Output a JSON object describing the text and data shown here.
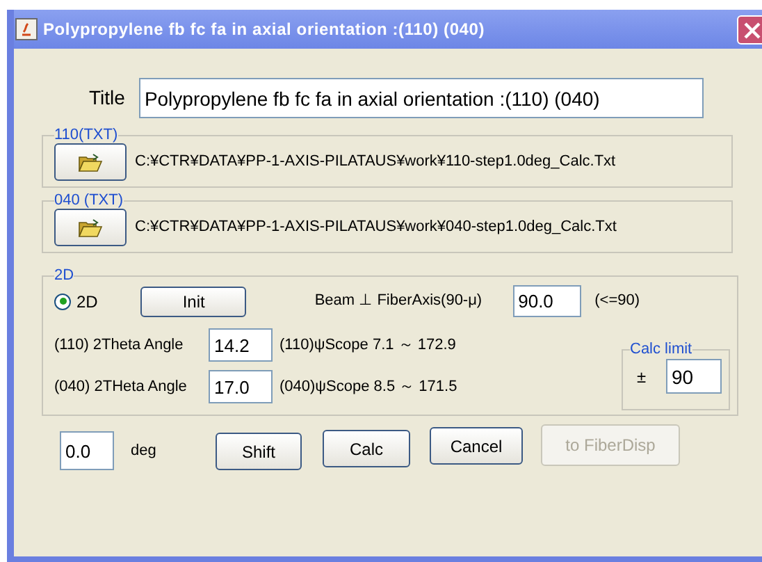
{
  "window": {
    "title": "Polypropylene fb fc fa in axial orientation :(110) (040)"
  },
  "title_field": {
    "label": "Title",
    "value": "Polypropylene fb fc fa in axial orientation :(110) (040)"
  },
  "files": [
    {
      "legend": "110(TXT)",
      "path": "C:¥CTR¥DATA¥PP-1-AXIS-PILATAUS¥work¥110-step1.0deg_Calc.Txt"
    },
    {
      "legend": "040 (TXT)",
      "path": "C:¥CTR¥DATA¥PP-1-AXIS-PILATAUS¥work¥040-step1.0deg_Calc.Txt"
    }
  ],
  "group_2d": {
    "legend": "2D",
    "radio": {
      "label": "2D",
      "selected": true
    },
    "init_button": "Init",
    "beam_label": "Beam ⊥ FiberAxis(90-μ)",
    "beam_value": "90.0",
    "beam_hint": "(<=90)",
    "angles": [
      {
        "label": "(110) 2Theta Angle",
        "value": "14.2",
        "scope": "(110)ψScope 7.1 ～ 172.9"
      },
      {
        "label": "(040) 2THeta Angle",
        "value": "17.0",
        "scope": "(040)ψScope 8.5 ～ 171.5"
      }
    ],
    "calc_limit": {
      "legend": "Calc limit",
      "sign": "±",
      "value": "90"
    }
  },
  "shift": {
    "value": "0.0",
    "unit": "deg"
  },
  "buttons": [
    {
      "label": "Shift",
      "disabled": false
    },
    {
      "label": "Calc",
      "disabled": false
    },
    {
      "label": "Cancel",
      "disabled": false
    },
    {
      "label": "to FiberDisp",
      "disabled": true
    }
  ]
}
